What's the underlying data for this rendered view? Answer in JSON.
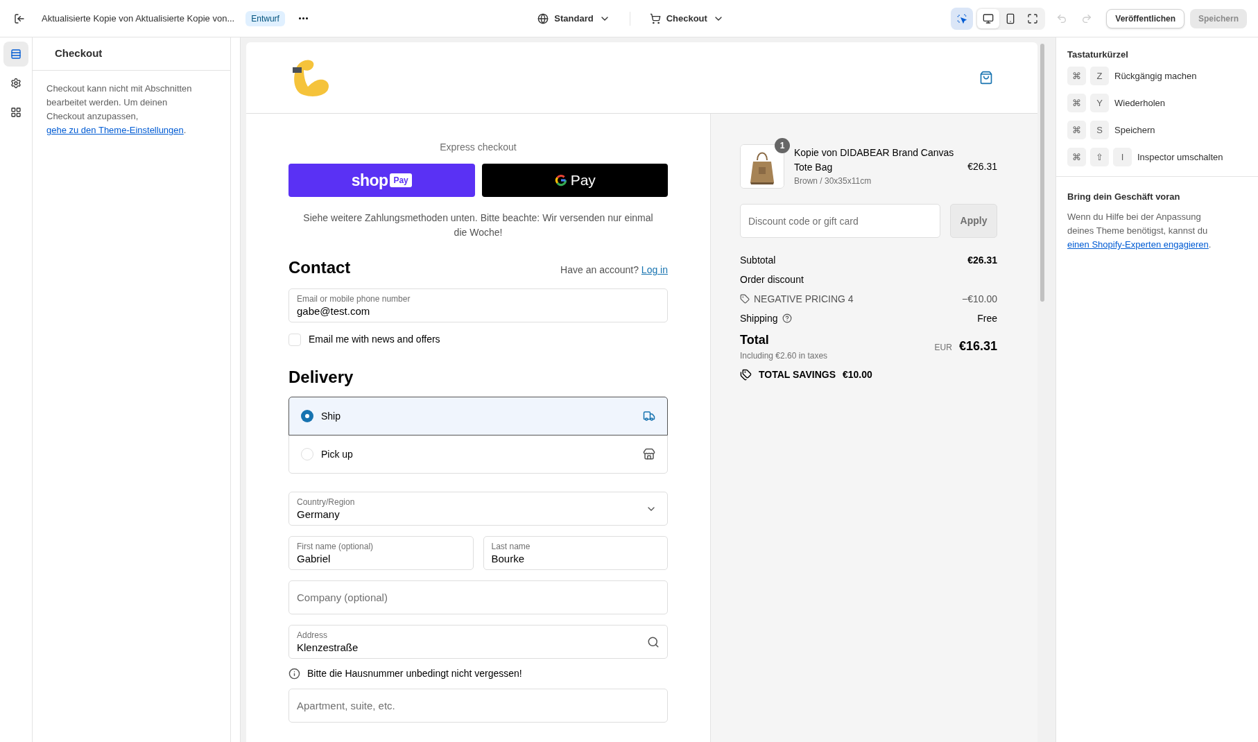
{
  "topbar": {
    "title": "Aktualisierte Kopie von Aktualisierte Kopie von...",
    "status": "Entwurf",
    "theme_menu": "Standard",
    "page_menu": "Checkout",
    "inspector": {
      "on": true
    },
    "view_modes": [
      {
        "kind": "desktop",
        "selected": true
      },
      {
        "kind": "mobile",
        "selected": false
      },
      {
        "kind": "fullscreen",
        "selected": false
      }
    ],
    "history": [
      {
        "kind": "undo",
        "disabled": true
      },
      {
        "kind": "redo",
        "disabled": true
      }
    ],
    "publish": "Veröffentlichen",
    "save": {
      "label": "Speichern",
      "disabled": true
    }
  },
  "rail": [
    {
      "kind": "sections",
      "selected": true
    },
    {
      "kind": "settings",
      "selected": false
    },
    {
      "kind": "apps",
      "selected": false
    }
  ],
  "sidebar": {
    "title": "Checkout",
    "text": "Checkout kann nicht mit Abschnitten bearbeitet werden. Um deinen Checkout anzupassen,",
    "link": "gehe zu den Theme-Einstellungen",
    "after_link": "."
  },
  "checkout": {
    "express_label": "Express checkout",
    "shop_pay": {
      "word": "shop",
      "badge": "Pay"
    },
    "google_pay": {
      "word": "Pay"
    },
    "notice": "Siehe weitere Zahlungsmethoden unten. Bitte beachte: Wir versenden nur einmal die Woche!",
    "contact": {
      "heading": "Contact",
      "account_prompt": "Have an account?",
      "login_link": "Log in",
      "email": {
        "label": "Email or mobile phone number",
        "value": "gabe@test.com"
      },
      "newsletter": {
        "label": "Email me with news and offers",
        "checked": false
      }
    },
    "delivery": {
      "heading": "Delivery",
      "options": [
        {
          "kind": "ship",
          "label": "Ship",
          "selected": true
        },
        {
          "kind": "pickup",
          "label": "Pick up",
          "selected": false
        }
      ],
      "fields": [
        {
          "kind": "select",
          "label": "Country/Region",
          "value": "Germany"
        },
        {
          "kind": "pair",
          "fields": [
            {
              "label": "First name (optional)",
              "value": "Gabriel"
            },
            {
              "label": "Last name",
              "value": "Bourke"
            }
          ]
        },
        {
          "kind": "empty",
          "placeholder": "Company (optional)"
        },
        {
          "kind": "search",
          "label": "Address",
          "value": "Klenzestraße"
        },
        {
          "kind": "note",
          "text": "Bitte die Hausnummer unbedingt nicht vergessen!"
        },
        {
          "kind": "empty",
          "placeholder": "Apartment, suite, etc."
        }
      ]
    }
  },
  "summary": {
    "item": {
      "quantity": "1",
      "name": "Kopie von DIDABEAR Brand Canvas Tote Bag",
      "variant": "Brown / 30x35x11cm",
      "price": "€26.31"
    },
    "discount": {
      "placeholder": "Discount code or gift card",
      "button": "Apply"
    },
    "lines": [
      {
        "kind": "plain",
        "label": "Subtotal",
        "value": "€26.31"
      },
      {
        "kind": "heading",
        "label": "Order discount"
      },
      {
        "kind": "code",
        "label": "NEGATIVE PRICING 4",
        "value": "−€10.00"
      },
      {
        "kind": "help",
        "label": "Shipping",
        "value": "Free"
      }
    ],
    "total": {
      "label": "Total",
      "taxes": "Including €2.60 in taxes",
      "currency": "EUR",
      "value": "€16.31"
    },
    "savings": {
      "label": "TOTAL SAVINGS",
      "value": "€10.00"
    }
  },
  "shortcuts": {
    "title": "Tastaturkürzel",
    "items": [
      {
        "keys": [
          "⌘",
          "Z"
        ],
        "label": "Rückgängig machen"
      },
      {
        "keys": [
          "⌘",
          "Y"
        ],
        "label": "Wiederholen"
      },
      {
        "keys": [
          "⌘",
          "S"
        ],
        "label": "Speichern"
      },
      {
        "keys": [
          "⌘",
          "⇧",
          "I"
        ],
        "label": "Inspector umschalten"
      }
    ]
  },
  "growth": {
    "title": "Bring dein Geschäft voran",
    "text": "Wenn du Hilfe bei der Anpassung deines Theme benötigst, kannst du",
    "link": "einen Shopify-Experten engagieren",
    "after_link": "."
  }
}
